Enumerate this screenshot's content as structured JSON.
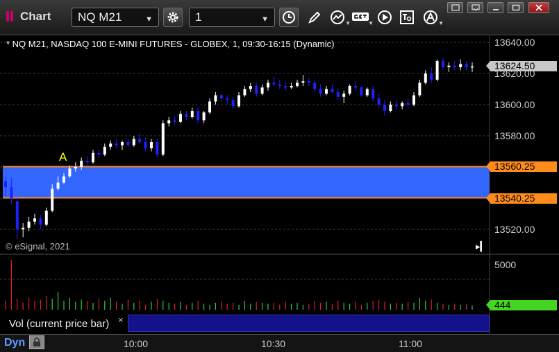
{
  "window": {
    "title": "Chart"
  },
  "toolbar": {
    "symbol_value": "NQ M21",
    "interval_value": "1"
  },
  "chart_info": {
    "description": "* NQ M21, NASDAQ 100 E-MINI FUTURES - GLOBEX, 1, 09:30-16:15 (Dynamic)",
    "copyright": "© eSignal, 2021",
    "marker_label": "A"
  },
  "price_axis": {
    "labels": [
      "13640.00",
      "13620.00",
      "13600.00",
      "13580.00",
      "13560.25",
      "13540.25",
      "13520.00"
    ],
    "current_price": "13624.50",
    "zone_high": "13560.25",
    "zone_low": "13540.25"
  },
  "volume_axis": {
    "label_max": "5000",
    "current_volume": "444"
  },
  "study": {
    "label": "Vol (current price bar)",
    "close": "×"
  },
  "time_axis": {
    "ticks": [
      "10:00",
      "10:30",
      "11:00"
    ],
    "mode": "Dyn"
  },
  "colors": {
    "zone_fill": "#3366ff",
    "zone_border": "#ff8c1a",
    "up_candle": "#ffffff",
    "down_candle": "#2020ff",
    "volume_up": "#2ecc40",
    "volume_down": "#e02020",
    "current_price_tag": "#c8c8c8",
    "volume_tag": "#44d622"
  },
  "chart_data": {
    "type": "candlestick",
    "y_range": [
      13508,
      13644
    ],
    "zone": {
      "low": 13540.25,
      "high": 13560.25
    },
    "ohlc": [
      [
        13551,
        13554,
        13541,
        13547
      ],
      [
        13547,
        13553,
        13536,
        13540
      ],
      [
        13538,
        13540,
        13514,
        13520
      ],
      [
        13520,
        13524,
        13515,
        13521
      ],
      [
        13521,
        13528,
        13519,
        13525
      ],
      [
        13525,
        13530,
        13523,
        13527
      ],
      [
        13527,
        13529,
        13520,
        13523
      ],
      [
        13523,
        13534,
        13522,
        13532
      ],
      [
        13532,
        13549,
        13531,
        13546
      ],
      [
        13546,
        13554,
        13545,
        13550
      ],
      [
        13550,
        13556,
        13549,
        13554
      ],
      [
        13554,
        13561,
        13553,
        13559
      ],
      [
        13559,
        13563,
        13557,
        13560
      ],
      [
        13560,
        13566,
        13558,
        13564
      ],
      [
        13564,
        13567,
        13561,
        13563
      ],
      [
        13563,
        13571,
        13562,
        13569
      ],
      [
        13569,
        13571,
        13566,
        13568
      ],
      [
        13568,
        13575,
        13567,
        13573
      ],
      [
        13573,
        13577,
        13571,
        13575
      ],
      [
        13575,
        13578,
        13572,
        13574
      ],
      [
        13574,
        13577,
        13571,
        13576
      ],
      [
        13576,
        13578,
        13573,
        13574
      ],
      [
        13574,
        13580,
        13573,
        13578
      ],
      [
        13578,
        13582,
        13575,
        13576
      ],
      [
        13576,
        13579,
        13570,
        13572
      ],
      [
        13572,
        13578,
        13570,
        13576
      ],
      [
        13576,
        13578,
        13566,
        13568
      ],
      [
        13568,
        13590,
        13567,
        13588
      ],
      [
        13588,
        13592,
        13586,
        13590
      ],
      [
        13590,
        13593,
        13587,
        13589
      ],
      [
        13589,
        13596,
        13588,
        13594
      ],
      [
        13594,
        13596,
        13590,
        13592
      ],
      [
        13592,
        13598,
        13591,
        13596
      ],
      [
        13596,
        13598,
        13588,
        13590
      ],
      [
        13590,
        13596,
        13588,
        13595
      ],
      [
        13595,
        13604,
        13594,
        13602
      ],
      [
        13602,
        13608,
        13600,
        13606
      ],
      [
        13606,
        13607,
        13602,
        13604
      ],
      [
        13604,
        13606,
        13600,
        13603
      ],
      [
        13603,
        13605,
        13597,
        13599
      ],
      [
        13599,
        13608,
        13598,
        13606
      ],
      [
        13606,
        13612,
        13605,
        13610
      ],
      [
        13610,
        13614,
        13608,
        13612
      ],
      [
        13612,
        13614,
        13605,
        13607
      ],
      [
        13607,
        13613,
        13606,
        13611
      ],
      [
        13611,
        13616,
        13609,
        13614
      ],
      [
        13614,
        13618,
        13612,
        13613
      ],
      [
        13613,
        13616,
        13610,
        13612
      ],
      [
        13612,
        13615,
        13609,
        13611
      ],
      [
        13611,
        13614,
        13610,
        13612
      ],
      [
        13612,
        13616,
        13611,
        13614
      ],
      [
        13614,
        13619,
        13612,
        13615
      ],
      [
        13615,
        13617,
        13612,
        13614
      ],
      [
        13614,
        13616,
        13608,
        13610
      ],
      [
        13610,
        13613,
        13605,
        13607
      ],
      [
        13607,
        13612,
        13606,
        13610
      ],
      [
        13610,
        13613,
        13607,
        13608
      ],
      [
        13608,
        13611,
        13603,
        13605
      ],
      [
        13605,
        13609,
        13601,
        13607
      ],
      [
        13607,
        13613,
        13606,
        13612
      ],
      [
        13612,
        13615,
        13609,
        13611
      ],
      [
        13611,
        13612,
        13605,
        13606
      ],
      [
        13606,
        13611,
        13605,
        13610
      ],
      [
        13610,
        13612,
        13602,
        13604
      ],
      [
        13604,
        13607,
        13598,
        13600
      ],
      [
        13600,
        13603,
        13593,
        13596
      ],
      [
        13596,
        13602,
        13595,
        13600
      ],
      [
        13600,
        13603,
        13597,
        13599
      ],
      [
        13599,
        13602,
        13597,
        13601
      ],
      [
        13601,
        13604,
        13598,
        13600
      ],
      [
        13600,
        13608,
        13599,
        13606
      ],
      [
        13606,
        13616,
        13605,
        13614
      ],
      [
        13614,
        13622,
        13613,
        13620
      ],
      [
        13620,
        13624,
        13614,
        13616
      ],
      [
        13616,
        13629,
        13615,
        13628
      ],
      [
        13628,
        13630,
        13622,
        13624
      ],
      [
        13624,
        13627,
        13621,
        13625
      ],
      [
        13625,
        13628,
        13622,
        13624
      ],
      [
        13624,
        13629,
        13622,
        13626
      ],
      [
        13626,
        13628,
        13622,
        13624
      ],
      [
        13624,
        13627,
        13621,
        13624.5
      ]
    ],
    "volume": [
      900,
      5000,
      1100,
      700,
      1200,
      900,
      1000,
      1400,
      1100,
      1800,
      900,
      1200,
      800,
      1000,
      900,
      700,
      1100,
      900,
      1200,
      800,
      600,
      1000,
      700,
      900,
      500,
      800,
      1100,
      900,
      700,
      600,
      800,
      500,
      700,
      900,
      600,
      500,
      700,
      800,
      600,
      700,
      500,
      900,
      600,
      800,
      700,
      600,
      700,
      500,
      800,
      600,
      700,
      500,
      600,
      900,
      700,
      800,
      600,
      900,
      700,
      600,
      800,
      500,
      700,
      900,
      1000,
      800,
      600,
      700,
      600,
      800,
      700,
      1200,
      900,
      1000,
      700,
      600,
      500,
      600,
      500,
      600,
      444
    ]
  }
}
